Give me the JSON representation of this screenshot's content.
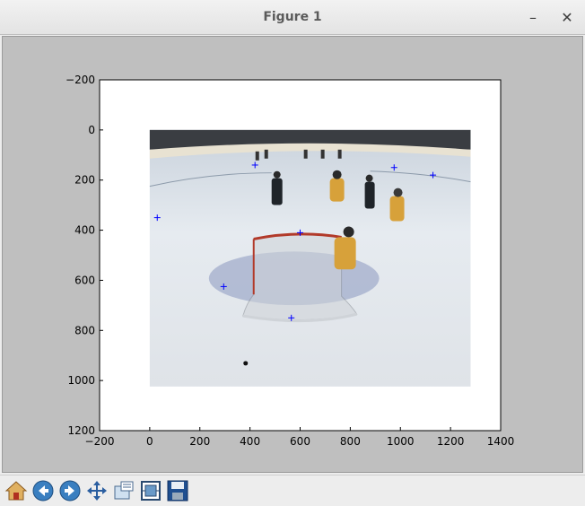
{
  "window": {
    "title": "Figure 1",
    "minimize_label": "–",
    "close_label": "✕"
  },
  "chart_data": {
    "type": "scatter",
    "xlim": [
      -200,
      1400
    ],
    "ylim": [
      1200,
      -200
    ],
    "y_inverted": true,
    "x_ticks": [
      "−200",
      "0",
      "200",
      "400",
      "600",
      "800",
      "1000",
      "1200",
      "1400"
    ],
    "y_ticks": [
      "−200",
      "0",
      "200",
      "400",
      "600",
      "800",
      "1000",
      "1200"
    ],
    "x_tick_values": [
      -200,
      0,
      200,
      400,
      600,
      800,
      1000,
      1200,
      1400
    ],
    "y_tick_values": [
      -200,
      0,
      200,
      400,
      600,
      800,
      1000,
      1200
    ],
    "image_extent": {
      "x": [
        0,
        1280
      ],
      "y": [
        0,
        1024
      ]
    },
    "series": [
      {
        "marker": "+",
        "color": "#0000ff",
        "points": [
          {
            "x": 420,
            "y": 140
          },
          {
            "x": 975,
            "y": 150
          },
          {
            "x": 1130,
            "y": 180
          },
          {
            "x": 30,
            "y": 350
          },
          {
            "x": 600,
            "y": 410
          },
          {
            "x": 295,
            "y": 625
          },
          {
            "x": 565,
            "y": 750
          }
        ]
      }
    ],
    "grid": false,
    "background": "#bfbfbf",
    "axes_face": "#ffffff"
  },
  "toolbar": {
    "home": "home-icon",
    "back": "back-arrow-icon",
    "forward": "forward-arrow-icon",
    "pan": "pan-icon",
    "zoom": "zoom-icon",
    "subplots": "subplots-icon",
    "save": "save-icon"
  }
}
